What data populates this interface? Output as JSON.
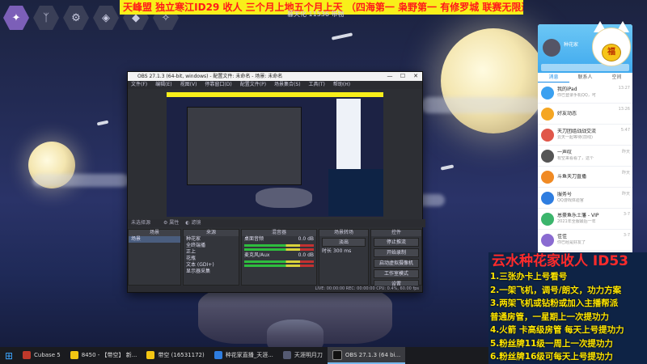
{
  "marquee": "天峰盟 独立寒江ID29 收人 三个月上地五个月上天 （四海第一 枭野第一 有修罗城 联赛无限连胜）",
  "sub_marquee": "暮天化   11536 带物",
  "top_icons": [
    "nav-hex-icon",
    "feather-icon",
    "gear-icon",
    "shield-icon",
    "gem-icon",
    "star-icon"
  ],
  "obs": {
    "title": "OBS 27.1.3 (64-bit, windows) - 配置文件: 未命名 - 场景: 未命名",
    "menu": [
      "文件(F)",
      "编辑(E)",
      "视图(V)",
      "停靠窗口(D)",
      "配置文件(P)",
      "场景集合(S)",
      "工具(T)",
      "帮助(H)"
    ],
    "no_source": "未选择源",
    "props_button": "属性",
    "filters_button": "滤镜",
    "scenes_header": "场景",
    "scene_item": "场景",
    "sources_header": "来源",
    "sources": [
      "种花家",
      "全终端播",
      "正上",
      "花瓶",
      "文本 (GDI+)",
      "显示器采集"
    ],
    "mixer_header": "混音器",
    "mixer_tracks": [
      {
        "name": "桌面音频",
        "level": "0.0 dB"
      },
      {
        "name": "麦克风/Aux",
        "level": "0.0 dB"
      }
    ],
    "transition_header": "场景转场",
    "transition_type": "淡出",
    "duration_label": "时长",
    "duration_value": "300 ms",
    "controls_header": "控件",
    "controls": [
      "停止推流",
      "开始录制",
      "启动虚拟摄像机",
      "工作室模式",
      "设置",
      "退出"
    ],
    "status": "LIVE: 00:00:00   REC: 00:00:00   CPU: 0.4%, 60.00 fps"
  },
  "qq": {
    "nickname": "种花家",
    "tabs": [
      "消息",
      "联系人",
      "空间"
    ],
    "items": [
      {
        "title": "我的iPad",
        "sub": "你已登录手机QQ，可",
        "time": "13:27"
      },
      {
        "title": "好友动态",
        "sub": "",
        "time": "13:26"
      },
      {
        "title": "天刀团组战战交流",
        "sub": "云天一起等待(前线)",
        "time": "5:47"
      },
      {
        "title": "一声叹",
        "sub": "有空来看看了，这个",
        "time": "昨天"
      },
      {
        "title": "斗鱼天刀直播",
        "sub": "",
        "time": "昨天"
      },
      {
        "title": "服务号",
        "sub": "QQ游戏体验官",
        "time": "昨天"
      },
      {
        "title": "恩豪鱼乐土藩 - VIP",
        "sub": "2021年全服最后一年",
        "time": "3-7"
      },
      {
        "title": "佳佳",
        "sub": "你已经是好友了",
        "time": "3-7"
      }
    ]
  },
  "promo": {
    "title": "云水种花家收人 ID53",
    "lines": [
      "1.三张办卡上号看号",
      "2.一架飞机，调号/朗文，功力方案",
      "3.两架飞机或钻粉或加入主播帮派",
      "普通房管，一星期上一次提功力",
      "4.火箭 卡高级房管 每天上号提功力",
      "5.粉丝牌11级一周上一次提功力",
      "6.粉丝牌16级可每天上号提功力"
    ]
  },
  "taskbar": [
    {
      "label": "Cubase 5",
      "color": "#c0392b"
    },
    {
      "label": "8450 - 【带空】 新...",
      "color": "#f3c613"
    },
    {
      "label": "带空 (16531172)",
      "color": "#f3c613"
    },
    {
      "label": "种花家直播_天涯...",
      "color": "#2e7de0"
    },
    {
      "label": "天涯明月刀",
      "color": "#555a72"
    },
    {
      "label": "OBS 27.1.3 (64 bi...",
      "color": "#111111"
    }
  ]
}
